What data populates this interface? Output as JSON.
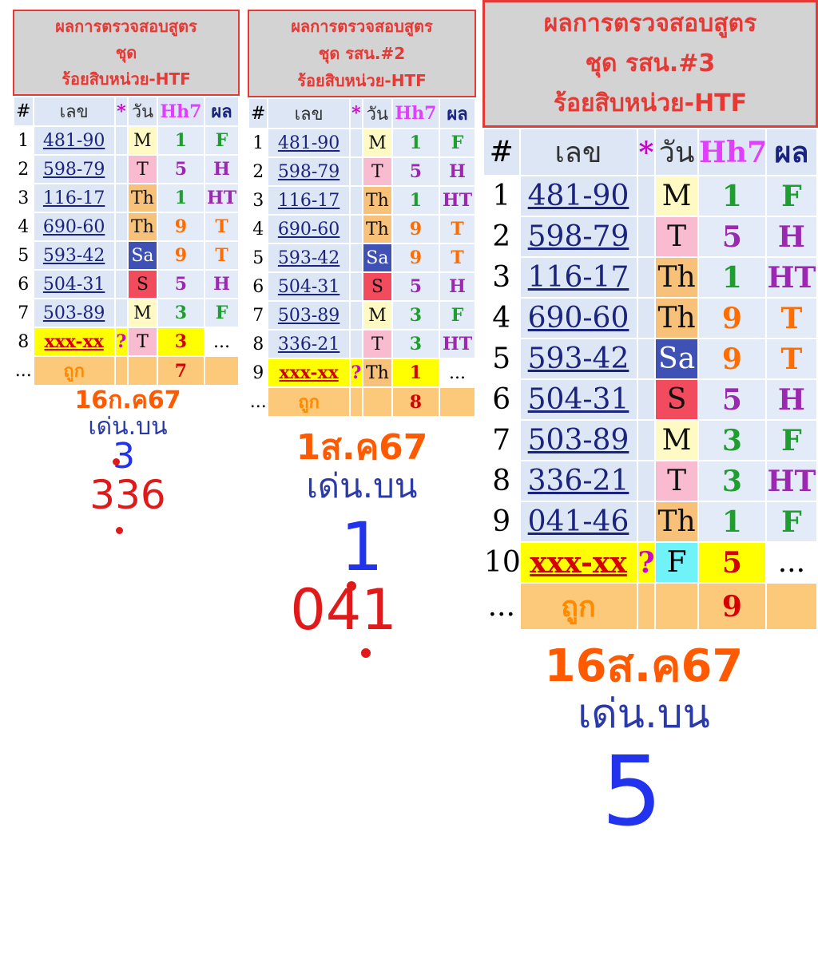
{
  "colors": {
    "title_red": "#e53935",
    "day": {
      "M": "#fff9c4",
      "T": "#f8bbd0",
      "Th": "#f8c17a",
      "Sa": "#3f51b5",
      "S": "#f14b5d",
      "F": "#6ff3f9"
    },
    "result": {
      "F": "#1e9e2f",
      "H": "#9c27b0",
      "HT": "#9c27b0",
      "T": "#ff6d00"
    },
    "hh7": {
      "1": "#1e9e2f",
      "3": "#1e9e2f",
      "5": "#9c27b0",
      "9": "#ff6d00"
    }
  },
  "headers": {
    "num": "#",
    "lek": "เลข",
    "star": "*",
    "wan": "วัน",
    "hh7": "Hh7",
    "phon": "ผล"
  },
  "panels": [
    {
      "title": [
        "ผลการตรวจสอบสูตร",
        "ชุด",
        "ร้อยสิบหน่วย-HTF"
      ],
      "rows": [
        {
          "n": "1",
          "code": "481-90",
          "day": "M",
          "hh7": "1",
          "res": "F"
        },
        {
          "n": "2",
          "code": "598-79",
          "day": "T",
          "hh7": "5",
          "res": "H"
        },
        {
          "n": "3",
          "code": "116-17",
          "day": "Th",
          "hh7": "1",
          "res": "HT"
        },
        {
          "n": "4",
          "code": "690-60",
          "day": "Th",
          "hh7": "9",
          "res": "T"
        },
        {
          "n": "5",
          "code": "593-42",
          "day": "Sa",
          "hh7": "9",
          "res": "T"
        },
        {
          "n": "6",
          "code": "504-31",
          "day": "S",
          "hh7": "5",
          "res": "H"
        },
        {
          "n": "7",
          "code": "503-89",
          "day": "M",
          "hh7": "3",
          "res": "F"
        }
      ],
      "pending": {
        "n": "8",
        "code": "xxx-xx",
        "q": "?",
        "day": "T",
        "hh7": "3",
        "res": "..."
      },
      "total": {
        "n": "...",
        "label": "ถูก",
        "count": "7"
      },
      "caption": {
        "date": "16ก.ค67",
        "kind": "เด่น.บน",
        "big": "3",
        "num": "336"
      }
    },
    {
      "title": [
        "ผลการตรวจสอบสูตร",
        "ชุด รสน.#2",
        "ร้อยสิบหน่วย-HTF"
      ],
      "rows": [
        {
          "n": "1",
          "code": "481-90",
          "day": "M",
          "hh7": "1",
          "res": "F"
        },
        {
          "n": "2",
          "code": "598-79",
          "day": "T",
          "hh7": "5",
          "res": "H"
        },
        {
          "n": "3",
          "code": "116-17",
          "day": "Th",
          "hh7": "1",
          "res": "HT"
        },
        {
          "n": "4",
          "code": "690-60",
          "day": "Th",
          "hh7": "9",
          "res": "T"
        },
        {
          "n": "5",
          "code": "593-42",
          "day": "Sa",
          "hh7": "9",
          "res": "T"
        },
        {
          "n": "6",
          "code": "504-31",
          "day": "S",
          "hh7": "5",
          "res": "H"
        },
        {
          "n": "7",
          "code": "503-89",
          "day": "M",
          "hh7": "3",
          "res": "F"
        },
        {
          "n": "8",
          "code": "336-21",
          "day": "T",
          "hh7": "3",
          "res": "HT"
        }
      ],
      "pending": {
        "n": "9",
        "code": "xxx-xx",
        "q": "?",
        "day": "Th",
        "hh7": "1",
        "res": "..."
      },
      "total": {
        "n": "...",
        "label": "ถูก",
        "count": "8"
      },
      "caption": {
        "date": "1ส.ค67",
        "kind": "เด่น.บน",
        "big": "1",
        "num": "041"
      }
    },
    {
      "title": [
        "ผลการตรวจสอบสูตร",
        "ชุด รสน.#3",
        "ร้อยสิบหน่วย-HTF"
      ],
      "rows": [
        {
          "n": "1",
          "code": "481-90",
          "day": "M",
          "hh7": "1",
          "res": "F"
        },
        {
          "n": "2",
          "code": "598-79",
          "day": "T",
          "hh7": "5",
          "res": "H"
        },
        {
          "n": "3",
          "code": "116-17",
          "day": "Th",
          "hh7": "1",
          "res": "HT"
        },
        {
          "n": "4",
          "code": "690-60",
          "day": "Th",
          "hh7": "9",
          "res": "T"
        },
        {
          "n": "5",
          "code": "593-42",
          "day": "Sa",
          "hh7": "9",
          "res": "T"
        },
        {
          "n": "6",
          "code": "504-31",
          "day": "S",
          "hh7": "5",
          "res": "H"
        },
        {
          "n": "7",
          "code": "503-89",
          "day": "M",
          "hh7": "3",
          "res": "F"
        },
        {
          "n": "8",
          "code": "336-21",
          "day": "T",
          "hh7": "3",
          "res": "HT"
        },
        {
          "n": "9",
          "code": "041-46",
          "day": "Th",
          "hh7": "1",
          "res": "F"
        }
      ],
      "pending": {
        "n": "10",
        "code": "xxx-xx",
        "q": "?",
        "day": "F",
        "hh7": "5",
        "res": "..."
      },
      "total": {
        "n": "...",
        "label": "ถูก",
        "count": "9"
      },
      "caption": {
        "date": "16ส.ค67",
        "kind": "เด่น.บน",
        "big": "5",
        "num": ""
      }
    }
  ]
}
